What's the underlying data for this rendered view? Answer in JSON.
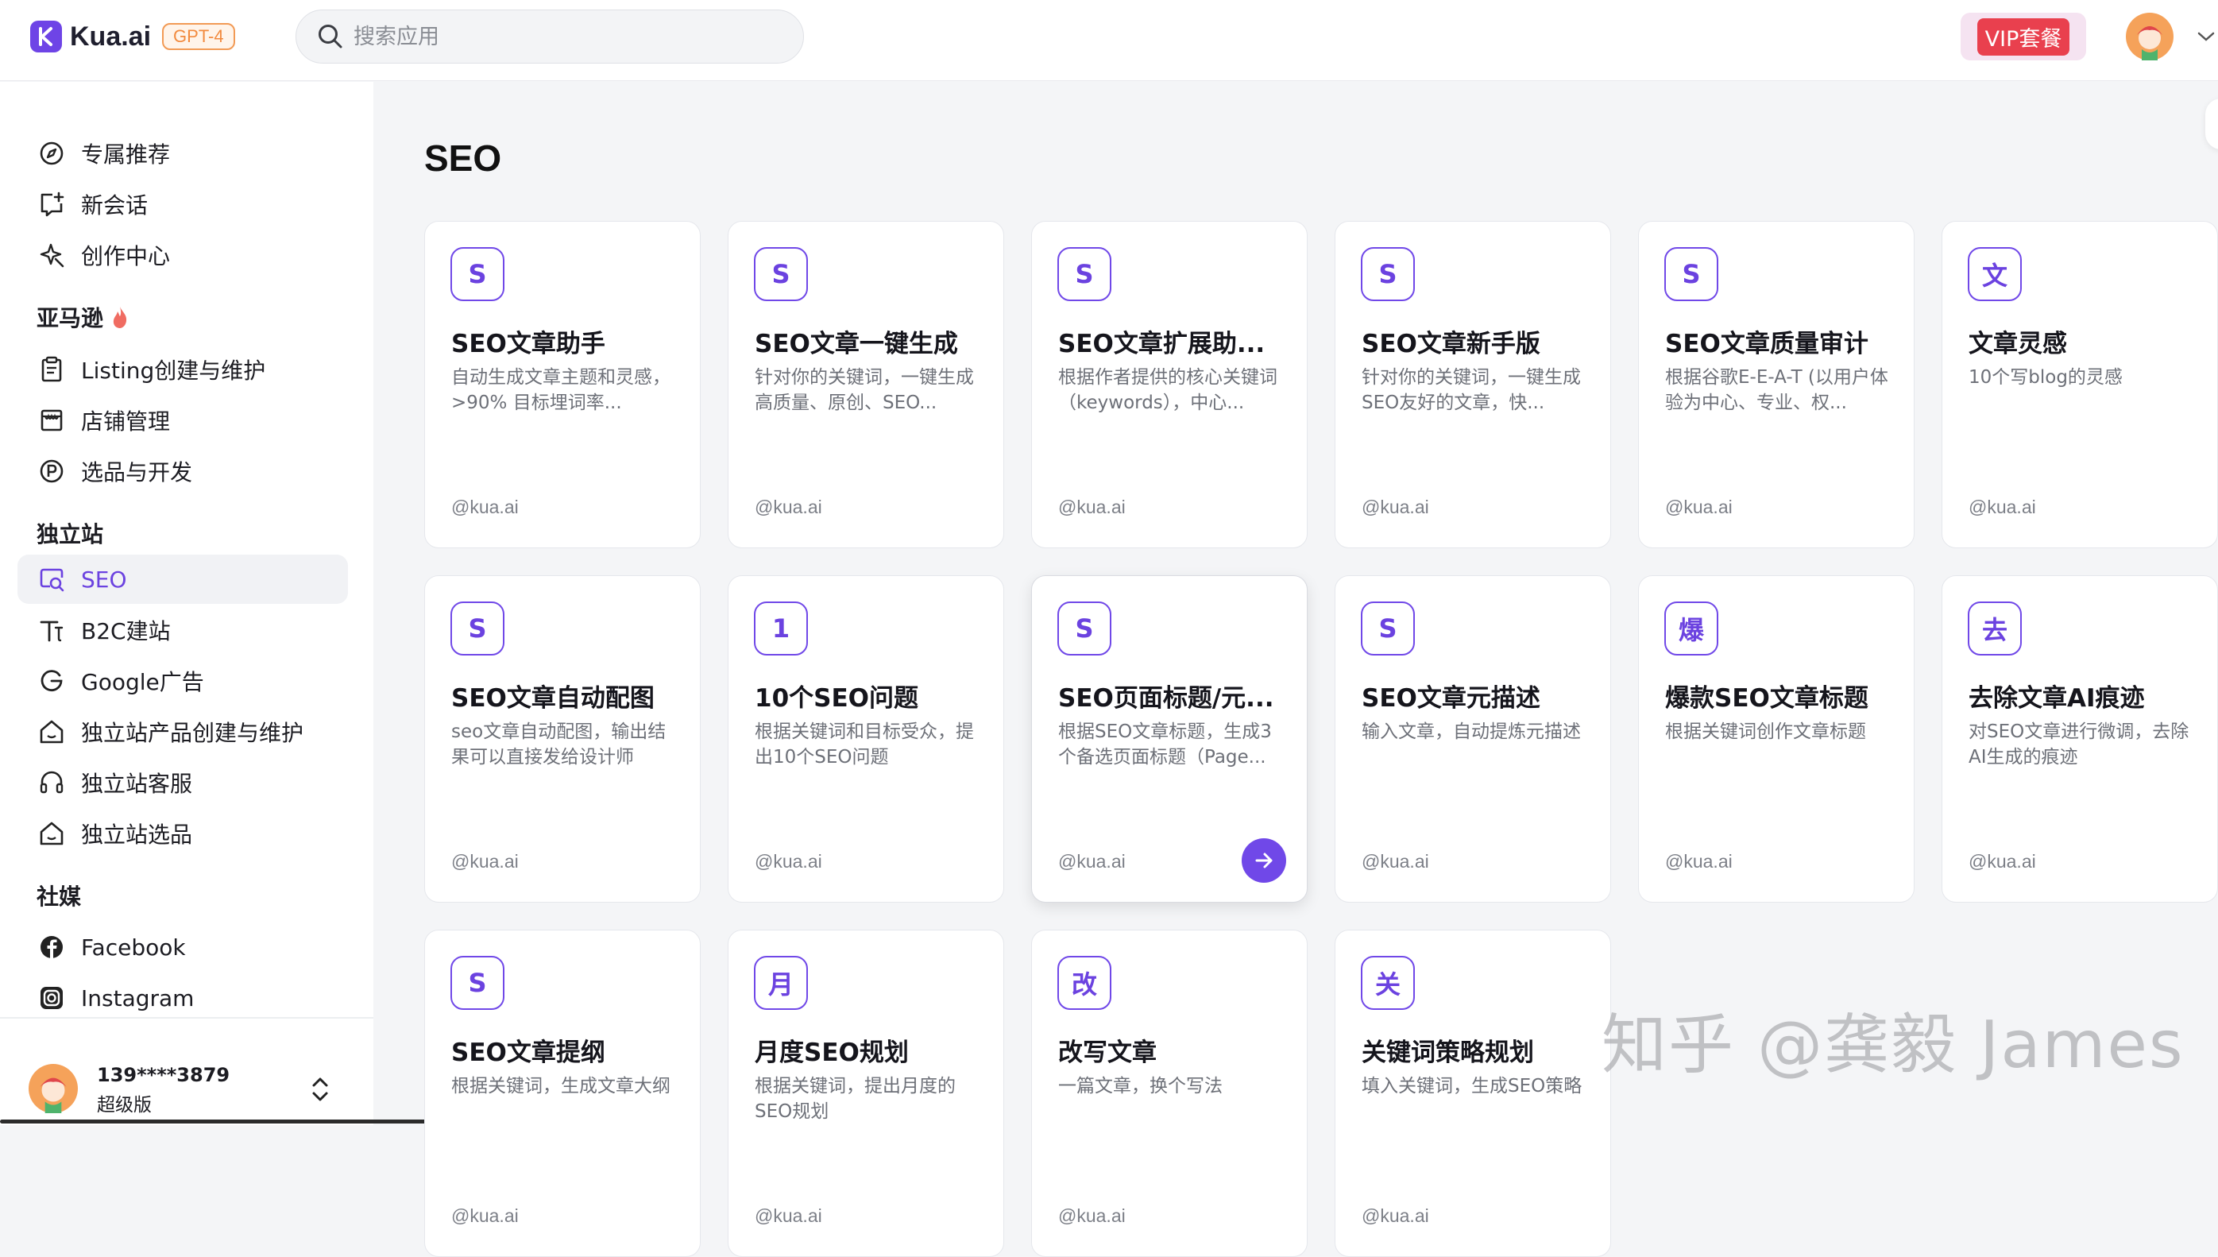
{
  "header": {
    "brand": "Kua.ai",
    "model_badge": "GPT-4",
    "search_placeholder": "搜索应用",
    "vip_label": "VIP套餐"
  },
  "sidebar": {
    "top_items": [
      {
        "label": "专属推荐",
        "icon": "compass-icon"
      },
      {
        "label": "新会话",
        "icon": "new-chat-icon"
      },
      {
        "label": "创作中心",
        "icon": "sparkle-icon"
      }
    ],
    "sections": [
      {
        "title": "亚马逊",
        "items": [
          {
            "label": "Listing创建与维护",
            "icon": "clipboard-icon"
          },
          {
            "label": "店铺管理",
            "icon": "store-icon"
          },
          {
            "label": "选品与开发",
            "icon": "product-p-icon"
          }
        ]
      },
      {
        "title": "独立站",
        "items": [
          {
            "label": "SEO",
            "icon": "seo-search-icon",
            "active": true
          },
          {
            "label": "B2C建站",
            "icon": "typography-icon"
          },
          {
            "label": "Google广告",
            "icon": "google-icon"
          },
          {
            "label": "独立站产品创建与维护",
            "icon": "house-icon"
          },
          {
            "label": "独立站客服",
            "icon": "headset-icon"
          },
          {
            "label": "独立站选品",
            "icon": "house-icon"
          }
        ]
      },
      {
        "title": "社媒",
        "items": [
          {
            "label": "Facebook",
            "icon": "facebook-icon"
          },
          {
            "label": "Instagram",
            "icon": "instagram-icon"
          }
        ]
      }
    ],
    "user": {
      "name": "139****3879",
      "plan": "超级版"
    }
  },
  "main": {
    "title": "SEO",
    "cards": [
      {
        "icon_text": "S",
        "title": "SEO文章助手",
        "desc": "自动生成文章主题和灵感，>90% 目标埋词率...",
        "author": "@kua.ai"
      },
      {
        "icon_text": "S",
        "title": "SEO文章一键生成",
        "desc": "针对你的关键词，一键生成高质量、原创、SEO...",
        "author": "@kua.ai"
      },
      {
        "icon_text": "S",
        "title": "SEO文章扩展助...",
        "desc": "根据作者提供的核心关键词（keywords），中心...",
        "author": "@kua.ai"
      },
      {
        "icon_text": "S",
        "title": "SEO文章新手版",
        "desc": "针对你的关键词，一键生成SEO友好的文章，快...",
        "author": "@kua.ai"
      },
      {
        "icon_text": "S",
        "title": "SEO文章质量审计",
        "desc": "根据谷歌E-E-A-T (以用户体验为中心、专业、权...",
        "author": "@kua.ai"
      },
      {
        "icon_text": "文",
        "title": "文章灵感",
        "desc": "10个写blog的灵感",
        "author": "@kua.ai"
      },
      {
        "icon_text": "S",
        "title": "SEO文章自动配图",
        "desc": "seo文章自动配图，输出结果可以直接发给设计师",
        "author": "@kua.ai"
      },
      {
        "icon_text": "1",
        "title": "10个SEO问题",
        "desc": "根据关键词和目标受众，提出10个SEO问题",
        "author": "@kua.ai"
      },
      {
        "icon_text": "S",
        "title": "SEO页面标题/元...",
        "desc": "根据SEO文章标题，生成3个备选页面标题（Page...",
        "author": "@kua.ai",
        "hover": true
      },
      {
        "icon_text": "S",
        "title": "SEO文章元描述",
        "desc": "输入文章，自动提炼元描述",
        "author": "@kua.ai"
      },
      {
        "icon_text": "爆",
        "title": "爆款SEO文章标题",
        "desc": "根据关键词创作文章标题",
        "author": "@kua.ai"
      },
      {
        "icon_text": "去",
        "title": "去除文章AI痕迹",
        "desc": "对SEO文章进行微调，去除AI生成的痕迹",
        "author": "@kua.ai"
      },
      {
        "icon_text": "S",
        "title": "SEO文章提纲",
        "desc": "根据关键词，生成文章大纲",
        "author": "@kua.ai"
      },
      {
        "icon_text": "月",
        "title": "月度SEO规划",
        "desc": "根据关键词，提出月度的SEO规划",
        "author": "@kua.ai"
      },
      {
        "icon_text": "改",
        "title": "改写文章",
        "desc": "一篇文章，换个写法",
        "author": "@kua.ai"
      },
      {
        "icon_text": "关",
        "title": "关键词策略规划",
        "desc": "填入关键词，生成SEO策略",
        "author": "@kua.ai"
      }
    ]
  },
  "watermark": "知乎 @龚毅 James",
  "colors": {
    "accent": "#7048e8",
    "vip_red": "#e9404e",
    "badge_orange": "#f28a3e"
  }
}
